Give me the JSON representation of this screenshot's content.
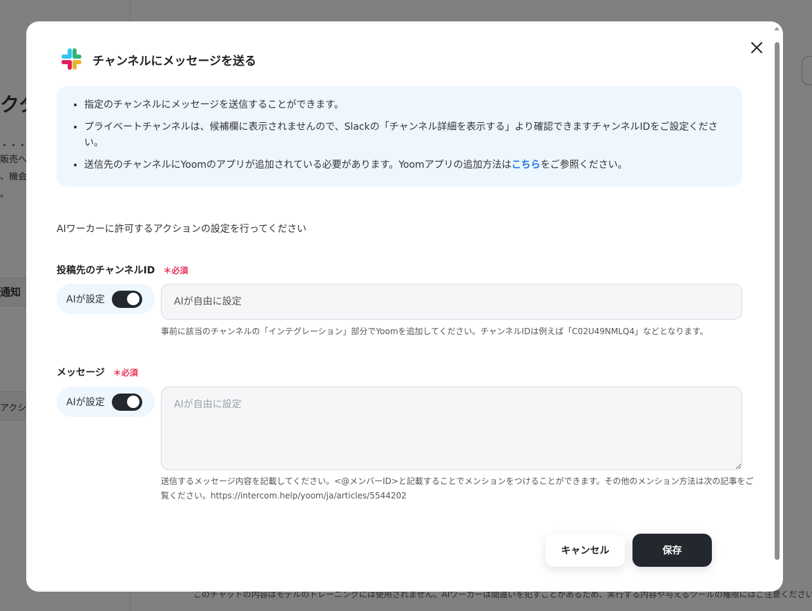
{
  "background": {
    "fragments": [
      "クタ",
      "・・・",
      "販売へ",
      "、機会",
      "。",
      "通知",
      "アクショ"
    ],
    "footer": "このチャットの内容はモデルのトレーニングには使用されません。AIワーカーは間違いを犯すことがあるため、実行する内容や与えるツールの権限にはご注意ください。テ"
  },
  "modal": {
    "title": "チャンネルにメッセージを送る",
    "icon": "slack-logo",
    "info": {
      "items": [
        "指定のチャンネルにメッセージを送信することができます。",
        "プライベートチャンネルは、候補欄に表示されませんので、Slackの「チャンネル詳細を表示する」より確認できますチャンネルIDをご設定ください。"
      ],
      "item3_before": "送信先のチャンネルにYoomのアプリが追加されている必要があります。Yoomアプリの追加方法は",
      "item3_link": "こちら",
      "item3_after": "をご参照ください。"
    },
    "intro": "AIワーカーに許可するアクションの設定を行ってください",
    "fields": [
      {
        "label": "投稿先のチャンネルID",
        "required": "＊必須",
        "ai_label": "AIが設定",
        "ai_enabled": true,
        "placeholder": "AIが自由に設定",
        "help": "事前に該当のチャンネルの「インテグレーション」部分でYoomを追加してください。チャンネルIDは例えば「C02U49NMLQ4」などとなります。"
      },
      {
        "label": "メッセージ",
        "required": "＊必須",
        "ai_label": "AIが設定",
        "ai_enabled": true,
        "placeholder": "AIが自由に設定",
        "help": "送信するメッセージ内容を記載してください。<@メンバーID>と記載することでメンションをつけることができます。その他のメンション方法は次の記事をご覧ください。https://intercom.help/yoom/ja/articles/5544202"
      }
    ],
    "cancel_label": "キャンセル",
    "save_label": "保存"
  },
  "colors": {
    "accent": "#23272e",
    "required": "#e8335a",
    "info_bg": "#eef6fe",
    "link": "#1a73e8"
  }
}
